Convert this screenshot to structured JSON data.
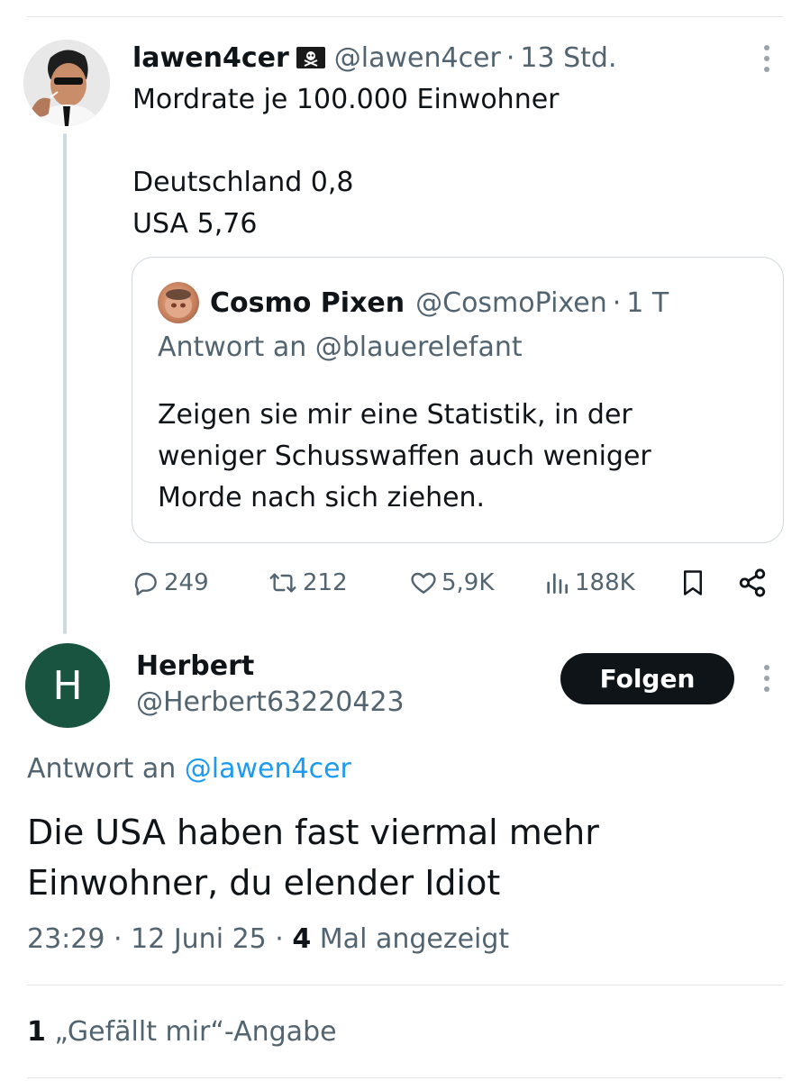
{
  "tweet": {
    "author_name": "lawen4cer",
    "author_handle": "@lawen4cer",
    "separator": "·",
    "time": "13 Std.",
    "text_lines": [
      "Mordrate je 100.000 Einwohner",
      "",
      "Deutschland 0,8",
      "USA 5,76"
    ],
    "quote": {
      "author_name": "Cosmo Pixen",
      "author_handle": "@CosmoPixen",
      "separator": "·",
      "time": "1 T",
      "reply_to": "Antwort an @blauerelefant",
      "text_lines": [
        "Zeigen sie mir eine Statistik, in der",
        "weniger Schusswaffen auch weniger",
        "Morde nach sich ziehen."
      ]
    },
    "actions": {
      "replies": "249",
      "retweets": "212",
      "likes": "5,9K",
      "views": "188K"
    }
  },
  "reply": {
    "avatar_letter": "H",
    "author_name": "Herbert",
    "author_handle": "@Herbert63220423",
    "follow_label": "Folgen",
    "reply_prefix": "Antwort an ",
    "reply_mention": "@lawen4cer",
    "text_lines": [
      "Die USA haben fast viermal mehr",
      "Einwohner, du elender Idiot"
    ],
    "time": "23:29",
    "date": "12 Juni 25",
    "separator": "·",
    "views_count": "4",
    "views_label": " Mal angezeigt",
    "likes_count": "1",
    "likes_label": " „Gefällt mir“-Angabe"
  },
  "colors": {
    "text": "#0f1419",
    "secondary": "#536471",
    "link": "#1d9bf0",
    "avatar_bg": "#195440",
    "button_bg": "#0f1419"
  },
  "icons": [
    "pirate-flag-icon",
    "more-icon",
    "reply-icon",
    "retweet-icon",
    "like-icon",
    "views-icon",
    "bookmark-icon",
    "share-icon"
  ]
}
